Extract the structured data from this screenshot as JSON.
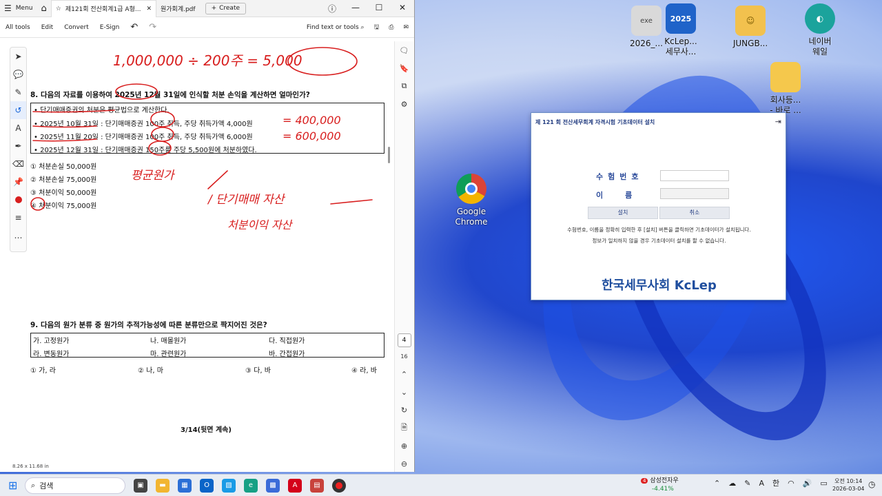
{
  "acrobat": {
    "menu_label": "Menu",
    "tabs": [
      {
        "label": "제121회 전산회계1급 A형..."
      },
      {
        "label": "원가회계.pdf"
      }
    ],
    "create_label": "Create",
    "tools": [
      "All tools",
      "Edit",
      "Convert",
      "E-Sign"
    ],
    "find_label": "Find text or tools",
    "page_current": "4",
    "page_total": "16",
    "doc_size": "8.26 x 11.68 in"
  },
  "document": {
    "q8": {
      "title": "8. 다음의 자료를 이용하여 2025년 12월 31일에 인식할 처분 손익을 계산하면 얼마인가?",
      "lines": [
        "• 단기매매증권의 처분은 평균법으로 계산한다.",
        "• 2025년 10월 31일 : 단기매매증권 100주 취득, 주당 취득가액 4,000원",
        "• 2025년 11월 20일 : 단기매매증권 100주 취득, 주당 취득가액 6,000원",
        "• 2025년 12월 31일 : 단기매매증권 150주를 주당 5,500원에 처분하였다."
      ],
      "choices": [
        "① 처분손실 50,000원",
        "② 처분손실 75,000원",
        "③ 처분이익 50,000원",
        "④ 처분이익 75,000원"
      ]
    },
    "q9": {
      "title": "9. 다음의 원가 분류 중 원가의 추적가능성에 따른 분류만으로 짝지어진 것은?",
      "cells": [
        "가. 고정원가",
        "나. 매몰원가",
        "다. 직접원가",
        "라. 변동원가",
        "마. 관련원가",
        "바. 간접원가"
      ],
      "choices": [
        "① 가, 라",
        "② 나, 마",
        "③ 다, 바",
        "④ 라, 바"
      ]
    },
    "page_footer": "3/14(뒷면 계속)",
    "handwriting": [
      "1,000,000 ÷ 200주 = 5,000",
      "= 400,000",
      "= 600,000",
      "평균원가",
      "/ 단기매매 자산",
      "처분이익 자산"
    ]
  },
  "kclep": {
    "title": "제 121 회 전산세무회계 자격시험 기초데이터 설치",
    "exam_no_label": "수험번호",
    "name_label": "이름",
    "install_button": "설치",
    "cancel_button": "취소",
    "note1": "수험번호, 이름을 정확히 입력한 후 [설치] 버튼을 클릭하면 기초데이터가 설치됩니다.",
    "note2": "정보가 일치하지 않을 경우 기초데이터 설치를 할 수 없습니다.",
    "brand": "한국세무사회 KcLep"
  },
  "desktop_icons": [
    {
      "label": "2026_...",
      "icon": "exe-icon"
    },
    {
      "label": "KcLep... 세무사...",
      "icon": "kclep-icon"
    },
    {
      "label": "JUNGB...",
      "icon": "folder-user-icon"
    },
    {
      "label": "네이버 웨일",
      "icon": "whale-icon"
    },
    {
      "label": "회사등... - 바로 ...",
      "icon": "folder-icon"
    },
    {
      "label": "Google Chrome",
      "icon": "chrome-icon"
    }
  ],
  "taskbar": {
    "search_placeholder": "검색",
    "stock_name": "삼성전자우",
    "stock_change": "-4.41%",
    "stock_badge": "4",
    "ime": "한",
    "time": "오전 10:14",
    "date": "2026-03-04",
    "tray_letter": "A"
  },
  "colors": {
    "kclep_blue": "#1f4e9e",
    "ink_red": "#d81e1e",
    "acrobat_red": "#d4001a"
  }
}
